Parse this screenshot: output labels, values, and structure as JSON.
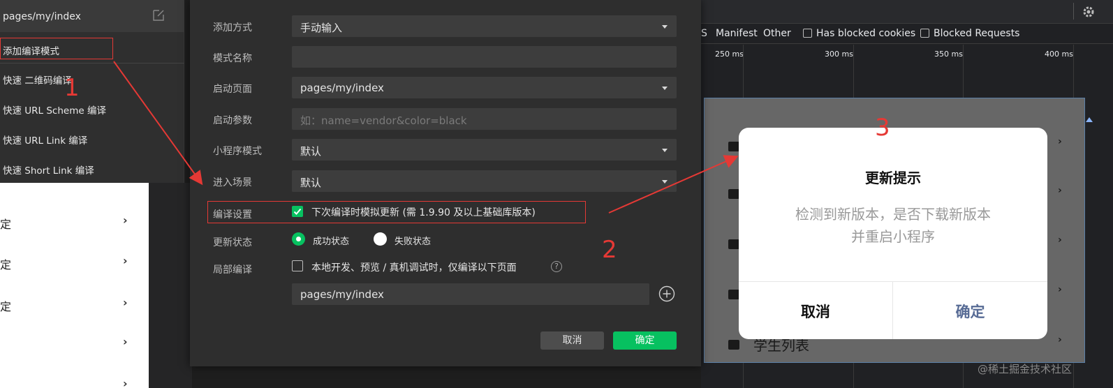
{
  "compile_menu": {
    "path": "pages/my/index",
    "items": [
      "添加编译模式",
      "快速 二维码编译",
      "快速 URL Scheme 编译",
      "快速 URL Link 编译",
      "快速 Short Link 编译"
    ]
  },
  "left_list": {
    "rows": [
      "定",
      "定",
      "定",
      "",
      ""
    ]
  },
  "form": {
    "add_method": {
      "label": "添加方式",
      "value": "手动输入"
    },
    "mode_name": {
      "label": "模式名称",
      "value": ""
    },
    "start_page": {
      "label": "启动页面",
      "value": "pages/my/index"
    },
    "start_params": {
      "label": "启动参数",
      "placeholder": "如：name=vendor&color=black"
    },
    "miniprogram_mode": {
      "label": "小程序模式",
      "value": "默认"
    },
    "scene": {
      "label": "进入场景",
      "value": "默认"
    },
    "compile_settings": {
      "label": "编译设置",
      "text": "下次编译时模拟更新 (需 1.9.90 及以上基础库版本)"
    },
    "update_status": {
      "label": "更新状态",
      "success": "成功状态",
      "fail": "失败状态"
    },
    "partial_compile": {
      "label": "局部编译",
      "text": "本地开发、预览 / 真机调试时，仅编译以下页面",
      "page": "pages/my/index"
    },
    "cancel_label": "取消",
    "ok_label": "确定"
  },
  "devtools": {
    "filters": [
      "S",
      "Manifest",
      "Other",
      "Has blocked cookies",
      "Blocked Requests"
    ],
    "ticks": [
      "250 ms",
      "300 ms",
      "350 ms",
      "400 ms"
    ]
  },
  "phone": {
    "last_row": "学生列表"
  },
  "update_dialog": {
    "title": "更新提示",
    "message_line1": "检测到新版本，是否下载新版本",
    "message_line2": "并重启小程序",
    "cancel": "取消",
    "ok": "确定"
  },
  "annotations": [
    "1",
    "2",
    "3"
  ],
  "watermark": "@稀土掘金技术社区",
  "colors": {
    "accent_green": "#07c160",
    "annotation_red": "#e53935",
    "dialog_ok_blue": "#576b95"
  }
}
